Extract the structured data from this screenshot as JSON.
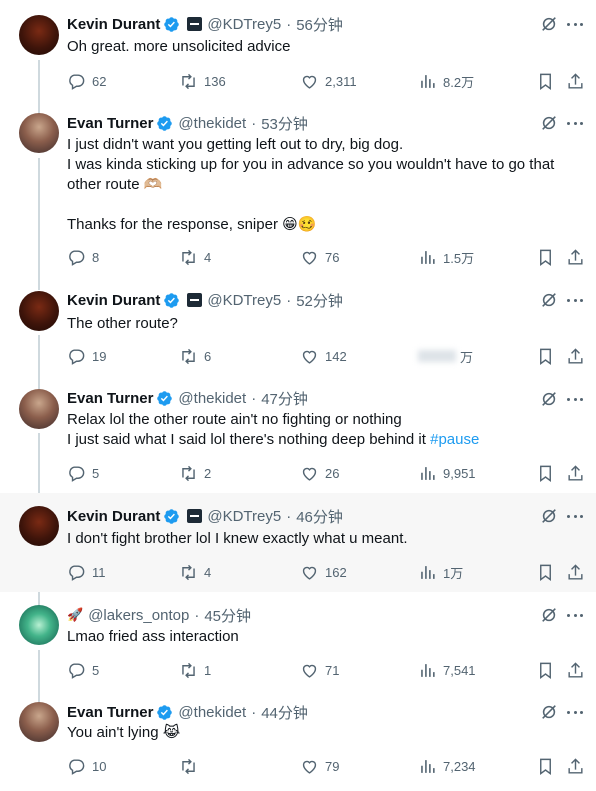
{
  "tweets": [
    {
      "name": "Kevin Durant",
      "handle": "@KDTrey5",
      "time": "56分钟",
      "lines": [
        "Oh great. more unsolicited advice"
      ],
      "replies": "62",
      "retweets": "136",
      "likes": "2,311",
      "views": "8.2万"
    },
    {
      "name": "Evan Turner",
      "handle": "@thekidet",
      "time": "53分钟",
      "lines": [
        "I just didn't want you getting left out to dry, big dog.",
        "I was kinda sticking up for you in advance so you wouldn't have to go that",
        "other route 🫶🏼",
        "",
        "Thanks for the response, sniper 😁🥴"
      ],
      "replies": "8",
      "retweets": "4",
      "likes": "76",
      "views": "1.5万"
    },
    {
      "name": "Kevin Durant",
      "handle": "@KDTrey5",
      "time": "52分钟",
      "lines": [
        "The other route?"
      ],
      "replies": "19",
      "retweets": "6",
      "likes": "142",
      "views": "万"
    },
    {
      "name": "Evan Turner",
      "handle": "@thekidet",
      "time": "47分钟",
      "line1": "Relax lol the other route ain't no fighting or nothing",
      "line2": "I just said what I said lol there's nothing deep behind it",
      "hashtag": "#pause",
      "replies": "5",
      "retweets": "2",
      "likes": "26",
      "views": "9,951"
    },
    {
      "name": "Kevin Durant",
      "handle": "@KDTrey5",
      "time": "46分钟",
      "lines": [
        "I don't fight brother lol I knew exactly what u meant."
      ],
      "replies": "11",
      "retweets": "4",
      "likes": "162",
      "views": "1万"
    },
    {
      "emoji": "🚀",
      "handle": "@lakers_ontop",
      "time": "45分钟",
      "lines": [
        "Lmao fried ass interaction"
      ],
      "replies": "5",
      "retweets": "1",
      "likes": "71",
      "views": "7,541"
    },
    {
      "name": "Evan Turner",
      "handle": "@thekidet",
      "time": "44分钟",
      "lines": [
        "You ain't lying 😹"
      ],
      "replies": "10",
      "retweets": "",
      "likes": "79",
      "views": "7,234"
    }
  ],
  "separator": "·",
  "colors": {
    "text": "#0f1419",
    "secondary": "#536471",
    "link": "#1d9bf0",
    "verified": "#1d9bf0",
    "thread": "#cfd9de"
  },
  "icons": [
    "reply-icon",
    "retweet-icon",
    "like-icon",
    "views-icon",
    "bookmark-icon",
    "share-icon",
    "grok-icon",
    "more-icon",
    "verified-badge-icon"
  ]
}
